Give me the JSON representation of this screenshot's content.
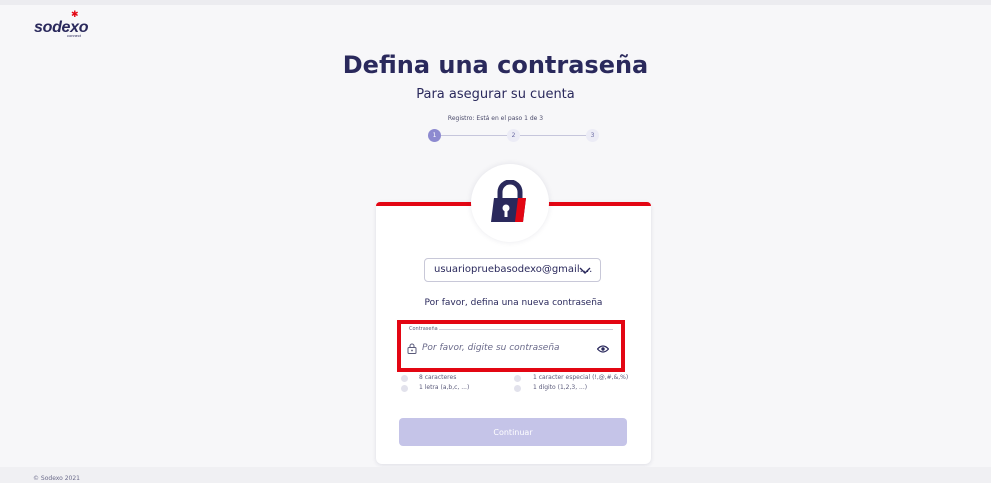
{
  "brand": {
    "logo_text": "sodexo",
    "logo_sub": "connect",
    "accent_color": "#e30613",
    "primary_color": "#2a295c"
  },
  "header": {
    "title": "Defina una contraseña",
    "subtitle": "Para asegurar su cuenta",
    "step_text": "Registro: Está en el paso 1 de 3"
  },
  "stepper": {
    "steps": [
      "1",
      "2",
      "3"
    ],
    "current": 1
  },
  "form": {
    "lock_icon": "padlock-icon",
    "email_value": "usuariopruebasodexo@gmail....",
    "helper_text": "Por favor, defina una nueva contraseña",
    "password_label": "Contraseña",
    "password_placeholder": "Por favor, digite su contraseña",
    "requirements": [
      "8 caracteres",
      "1 caracter especial (!,@,#,&,%)",
      "1 letra (a,b,c, ...)",
      "1 dígito (1,2,3, ...)"
    ],
    "continue_label": "Continuar"
  },
  "footer": {
    "copyright": "© Sodexo 2021"
  }
}
